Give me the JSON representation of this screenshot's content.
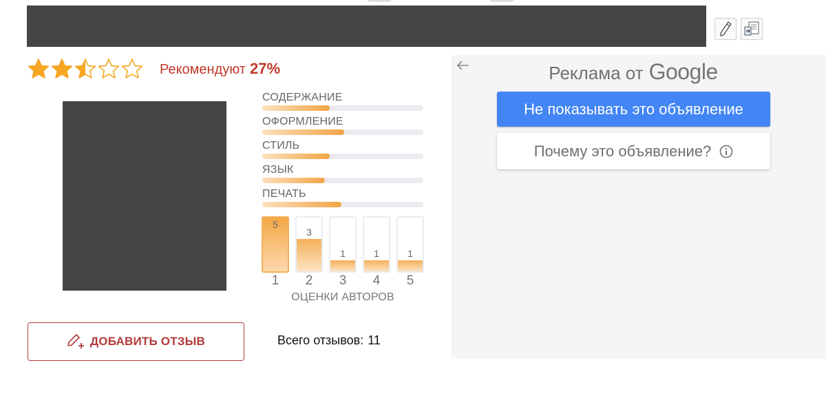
{
  "colors": {
    "accent_orange": "#f5a623",
    "brand_red": "#c0392b",
    "google_blue": "#4285f4",
    "placeholder_dark": "#454545"
  },
  "toolbar": {
    "edit_icon": "pencil-icon",
    "export_icon": "document-transfer-icon"
  },
  "rating": {
    "stars_total": 5,
    "stars_value": 2.5,
    "recommend_label": "Рекомендуют",
    "recommend_value": "27%"
  },
  "criteria": [
    {
      "label": "СОДЕРЖАНИЕ",
      "value": 0.42
    },
    {
      "label": "ОФОРМЛЕНИЕ",
      "value": 0.51
    },
    {
      "label": "СТИЛЬ",
      "value": 0.42
    },
    {
      "label": "ЯЗЫК",
      "value": 0.39
    },
    {
      "label": "ПЕЧАТЬ",
      "value": 0.49
    }
  ],
  "author_ratings": {
    "caption": "ОЦЕНКИ АВТОРОВ",
    "max_count": 5,
    "columns": [
      {
        "score": "1",
        "count": 5
      },
      {
        "score": "2",
        "count": 3
      },
      {
        "score": "3",
        "count": 1
      },
      {
        "score": "4",
        "count": 1
      },
      {
        "score": "5",
        "count": 1
      }
    ]
  },
  "add_review": {
    "label": "ДОБАВИТЬ ОТЗЫВ",
    "icon": "pencil-plus-icon"
  },
  "totals": {
    "label": "Всего отзывов:",
    "value": "11"
  },
  "ad": {
    "heading_prefix": "Реклама от",
    "heading_brand": "Google",
    "hide_ad_button": "Не показывать это объявление",
    "why_ad_button": "Почему это объявление?",
    "back_icon": "arrow-left-icon",
    "info_icon": "info-circle-icon"
  }
}
